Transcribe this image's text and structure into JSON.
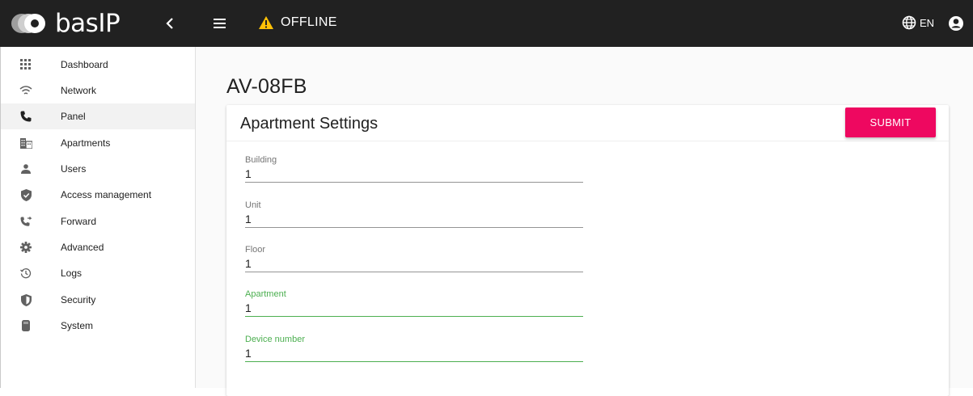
{
  "brand": {
    "name": "basIP"
  },
  "header": {
    "status": "OFFLINE",
    "language": "EN",
    "status_color": "#ffc107"
  },
  "sidebar": {
    "items": [
      {
        "label": "Dashboard",
        "icon": "grid-icon"
      },
      {
        "label": "Network",
        "icon": "wifi-icon"
      },
      {
        "label": "Panel",
        "icon": "phone-icon",
        "active": true
      },
      {
        "label": "Apartments",
        "icon": "building-icon"
      },
      {
        "label": "Users",
        "icon": "user-icon"
      },
      {
        "label": "Access management",
        "icon": "shield-check-icon"
      },
      {
        "label": "Forward",
        "icon": "phone-forward-icon"
      },
      {
        "label": "Advanced",
        "icon": "gear-icon"
      },
      {
        "label": "Logs",
        "icon": "history-icon"
      },
      {
        "label": "Security",
        "icon": "shield-icon"
      },
      {
        "label": "System",
        "icon": "device-icon"
      }
    ]
  },
  "main": {
    "device_name": "AV-08FB",
    "card_title": "Apartment Settings",
    "submit_label": "SUBMIT",
    "fields": [
      {
        "label": "Building",
        "value": "1"
      },
      {
        "label": "Unit",
        "value": "1"
      },
      {
        "label": "Floor",
        "value": "1"
      },
      {
        "label": "Apartment",
        "value": "1",
        "focused": true
      },
      {
        "label": "Device number",
        "value": "1",
        "focused": true
      }
    ]
  },
  "colors": {
    "topbar": "#212121",
    "accent": "#ee0860",
    "focus": "#4caf50"
  }
}
